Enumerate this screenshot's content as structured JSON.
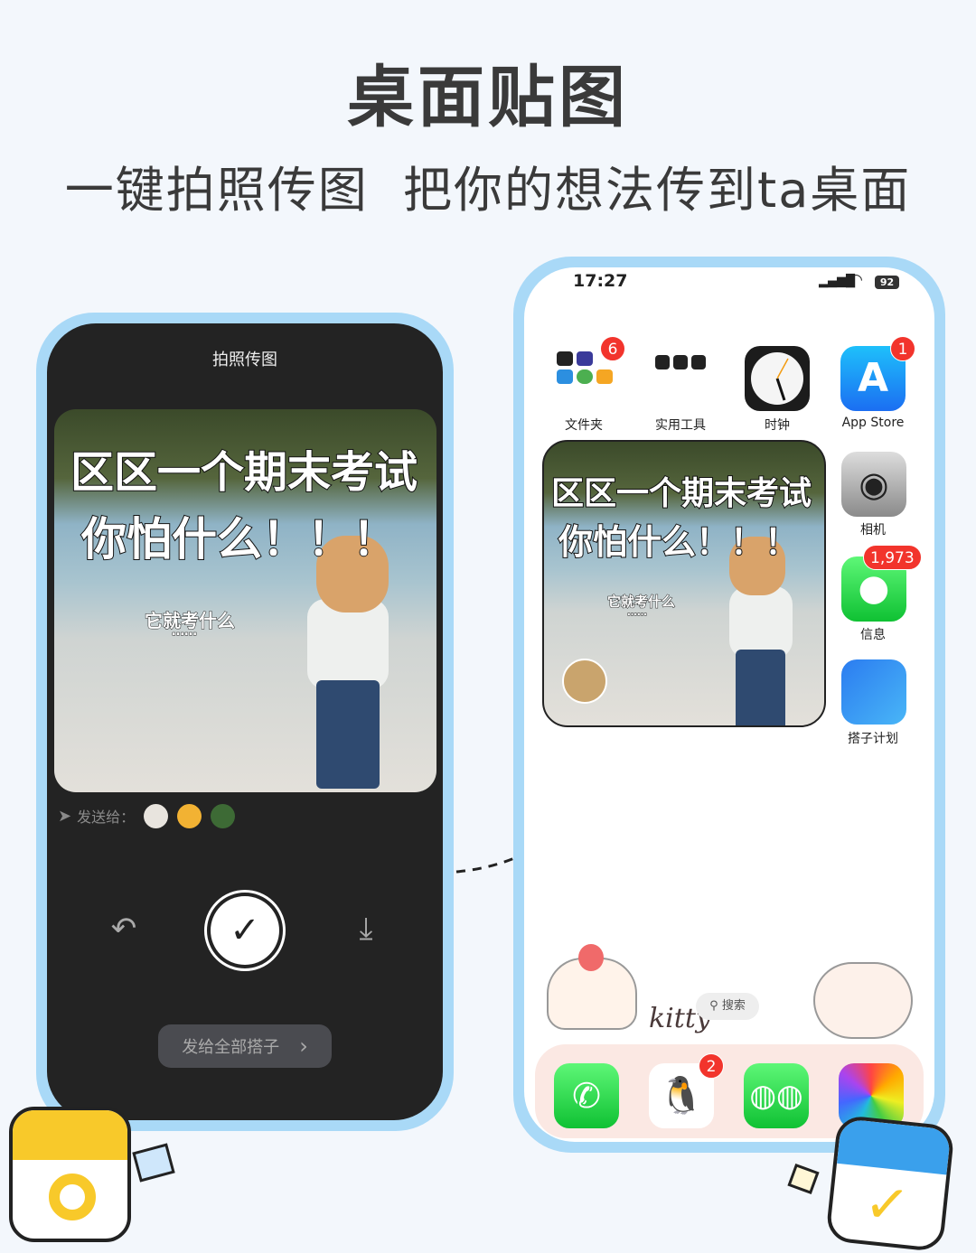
{
  "header": {
    "title": "桌面贴图",
    "subtitle": "一键拍照传图  把你的想法传到ta桌面"
  },
  "left_phone": {
    "title": "拍照传图",
    "photo": {
      "caption_line1": "区区一个期末考试",
      "caption_line2": "你怕什么！！！",
      "caption_small": "它就考什么",
      "caption_dots": "……"
    },
    "send_to_label": "发送给：",
    "recipients": [
      "duck-avatar",
      "sunglasses-duck-avatar",
      "green-avatar"
    ],
    "undo_icon": "undo-icon",
    "confirm_icon": "check-icon",
    "download_icon": "download-icon",
    "send_all_button": "发给全部搭子",
    "chevron": "›"
  },
  "right_phone": {
    "status": {
      "time": "17:27",
      "battery": "92"
    },
    "apps": [
      {
        "label": "文件夹",
        "badge": "6"
      },
      {
        "label": "实用工具"
      },
      {
        "label": "时钟"
      },
      {
        "label": "App Store",
        "badge": "1"
      }
    ],
    "side_apps": [
      {
        "label": "相机"
      },
      {
        "label": "信息",
        "badge": "1,973"
      },
      {
        "label": "搭子计划"
      }
    ],
    "widget": {
      "caption_line1": "区区一个期末考试",
      "caption_line2": "你怕什么！！！",
      "caption_small": "它就考什么",
      "caption_dots": "……"
    },
    "decor_text": "kitty",
    "search_label": "搜索",
    "dock": [
      {
        "name": "phone"
      },
      {
        "name": "qq",
        "badge": "2"
      },
      {
        "name": "wechat"
      },
      {
        "name": "photos"
      }
    ]
  },
  "colors": {
    "frame": "#a9d9f7",
    "dark_bg": "#232323",
    "badge": "#f2342c",
    "background": "#f3f7fc"
  }
}
